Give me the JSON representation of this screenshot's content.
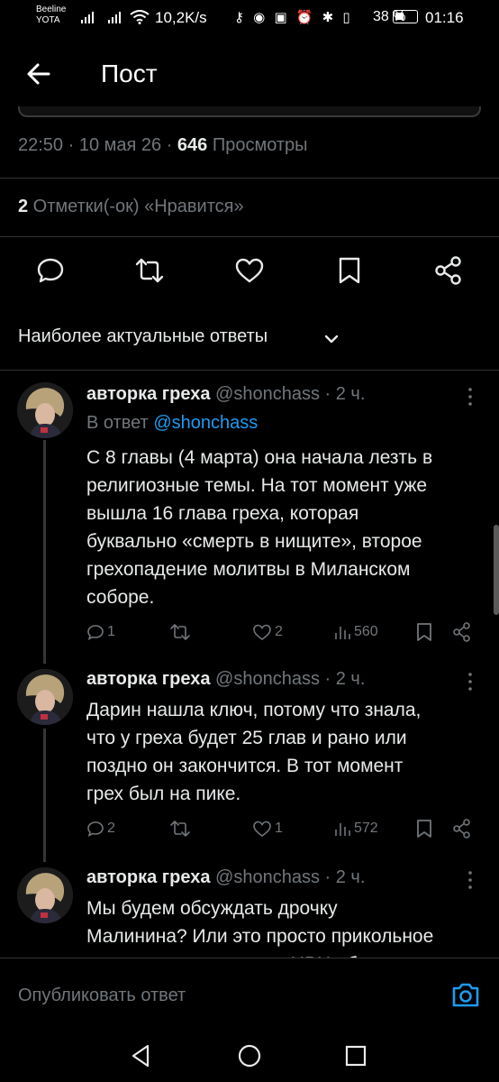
{
  "status_bar": {
    "carrier_1": "Beeline",
    "carrier_2": "YOTA",
    "speed": "10,2K/s",
    "battery": "38 %",
    "time": "01:16",
    "icons": [
      "key-icon",
      "eye-icon",
      "nfc-icon",
      "alarm-icon",
      "bluetooth-icon",
      "vibrate-icon",
      "battery-icon"
    ]
  },
  "header": {
    "title": "Пост"
  },
  "tweet_meta": {
    "time": "22:50 · 10 мая 26 · ",
    "views_count": "646",
    "views_label": " Просмотры"
  },
  "likes_line": {
    "count": "2",
    "label": " Отметки(-ок) «Нравится»"
  },
  "actions": [
    "reply-icon",
    "retweet-icon",
    "like-icon",
    "bookmark-icon",
    "share-icon"
  ],
  "sort": {
    "label": "Наиболее актуальные ответы"
  },
  "replies": [
    {
      "name": "авторка греха",
      "handle": " @shonchass · 2 ч.",
      "reply_to_prefix": "В ответ ",
      "reply_to_handle": "@shonchass",
      "text": "С 8 главы (4 марта) она начала лезть в\nрелигиозные темы. На тот момент уже\nвышла 16 глава греха, которая\nбуквально «смерть в нищите», второе\nгрехопадение молитвы в Миланском\nсоборе.",
      "replies": "1",
      "retweets": "",
      "likes": "2",
      "views": "560"
    },
    {
      "name": "авторка греха",
      "handle": " @shonchass · 2 ч.",
      "text": "Дарин нашла ключ, потому что знала,\nчто у греха будет 25 глав и рано или\nпоздно он закончится. В тот момент\nгрех был на пике.",
      "replies": "2",
      "retweets": "",
      "likes": "1",
      "views": "572"
    },
    {
      "name": "авторка греха",
      "handle": " @shonchass · 2 ч.",
      "text": "Мы будем обсуждать дрочку\nМалинина? Или это просто прикольное\nсовпадение, которое в НРЦ обсуждали"
    }
  ],
  "compose": {
    "placeholder": "Опубликовать ответ"
  },
  "colors": {
    "background": "#000000",
    "text": "#e7e9ea",
    "muted": "#71767b",
    "link": "#1d9bf0",
    "divider": "#2f3336"
  }
}
